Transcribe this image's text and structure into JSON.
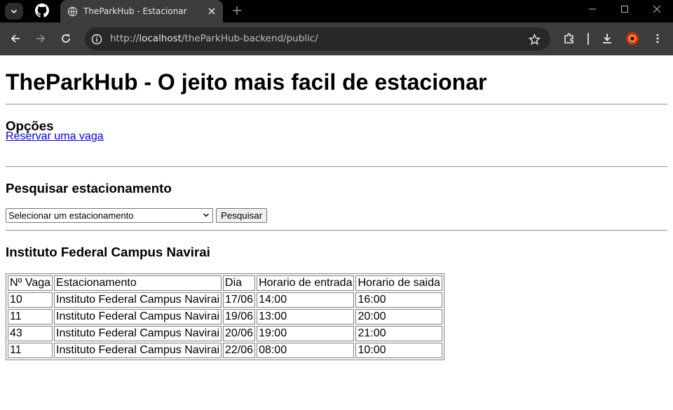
{
  "browser": {
    "tab_title": "TheParkHub - Estacionar",
    "url_prefix": "http://",
    "url_host": "localhost",
    "url_path": "/theParkHub-backend/public/",
    "icons": {
      "tab_search": "chevron-down-icon",
      "github": "github-icon",
      "favicon": "globe-icon",
      "close_tab": "close-icon",
      "new_tab": "plus-icon",
      "back": "arrow-left-icon",
      "forward": "arrow-right-icon",
      "reload": "reload-icon",
      "site_info": "info-icon",
      "bookmark": "star-icon",
      "extensions": "puzzle-icon",
      "downloads": "download-icon",
      "profile": "profile-avatar-icon",
      "menu": "kebab-menu-icon"
    }
  },
  "page": {
    "title": "TheParkHub - O jeito mais facil de estacionar",
    "options_heading": "Opções",
    "reserve_link": "Reservar uma vaga",
    "search_heading": "Pesquisar estacionamento",
    "select_value": "Selecionar um estacionamento",
    "search_button": "Pesquisar",
    "result_heading": "Instituto Federal Campus Navirai",
    "table": {
      "headers": [
        "Nº Vaga",
        "Estacionamento",
        "Dia",
        "Horario de entrada",
        "Horario de saida"
      ],
      "rows": [
        [
          "10",
          "Instituto Federal Campus Navirai",
          "17/06",
          "14:00",
          "16:00"
        ],
        [
          "11",
          "Instituto Federal Campus Navirai",
          "19/06",
          "13:00",
          "20:00"
        ],
        [
          "43",
          "Instituto Federal Campus Navirai",
          "20/06",
          "19:00",
          "21:00"
        ],
        [
          "11",
          "Instituto Federal Campus Navirai",
          "22/06",
          "08:00",
          "10:00"
        ]
      ]
    }
  },
  "colors": {
    "chrome_dark": "#000000",
    "chrome_toolbar": "#3c3c3c",
    "omnibox": "#282828",
    "link": "#0000ee"
  }
}
